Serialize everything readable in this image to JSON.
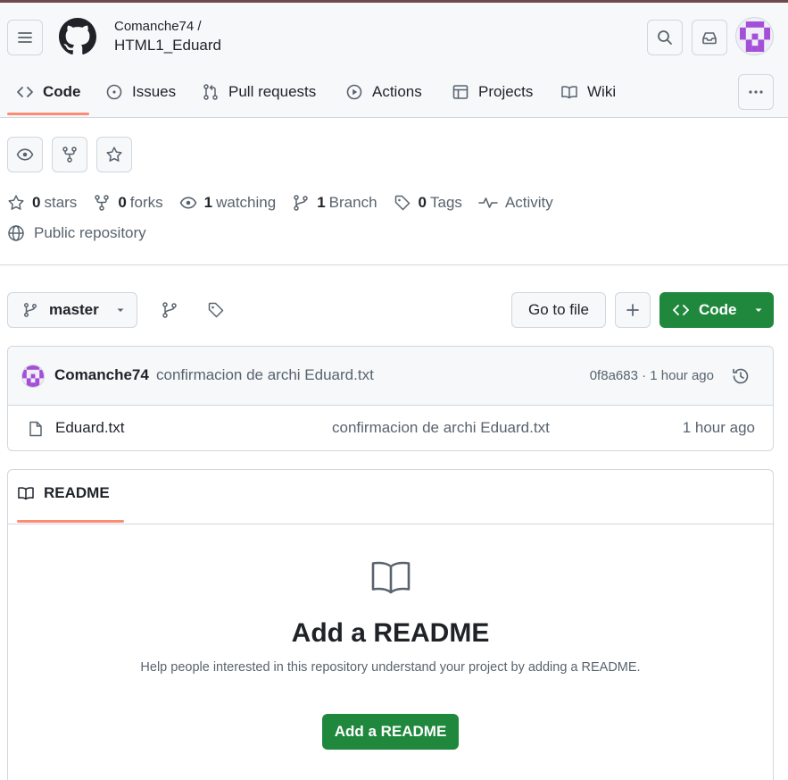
{
  "header": {
    "owner": "Comanche74 /",
    "repo": "HTML1_Eduard"
  },
  "tabs": [
    {
      "label": "Code",
      "icon": "code-icon"
    },
    {
      "label": "Issues",
      "icon": "issue-icon"
    },
    {
      "label": "Pull requests",
      "icon": "pull-request-icon"
    },
    {
      "label": "Actions",
      "icon": "play-icon"
    },
    {
      "label": "Projects",
      "icon": "table-icon"
    },
    {
      "label": "Wiki",
      "icon": "book-icon"
    }
  ],
  "stats": {
    "stars_count": "0",
    "stars_label": "stars",
    "forks_count": "0",
    "forks_label": "forks",
    "watching_count": "1",
    "watching_label": "watching",
    "branch_count": "1",
    "branch_label": "Branch",
    "tags_count": "0",
    "tags_label": "Tags",
    "activity_label": "Activity"
  },
  "visibility": "Public repository",
  "toolbar": {
    "branch": "master",
    "go_to_file": "Go to file",
    "code_label": "Code"
  },
  "latest_commit": {
    "author": "Comanche74",
    "message": "confirmacion de archi Eduard.txt",
    "meta": "0f8a683 · 1 hour ago"
  },
  "files": [
    {
      "name": "Eduard.txt",
      "message": "confirmacion de archi Eduard.txt",
      "time": "1 hour ago"
    }
  ],
  "readme": {
    "tab_label": "README",
    "title": "Add a README",
    "subtitle": "Help people interested in this repository understand your project by adding a README.",
    "button": "Add a README"
  },
  "colors": {
    "accent_green": "#1f883d",
    "tab_underline": "#fd8c73",
    "border": "#d0d7de",
    "avatar_purple": "#a44fd8"
  }
}
